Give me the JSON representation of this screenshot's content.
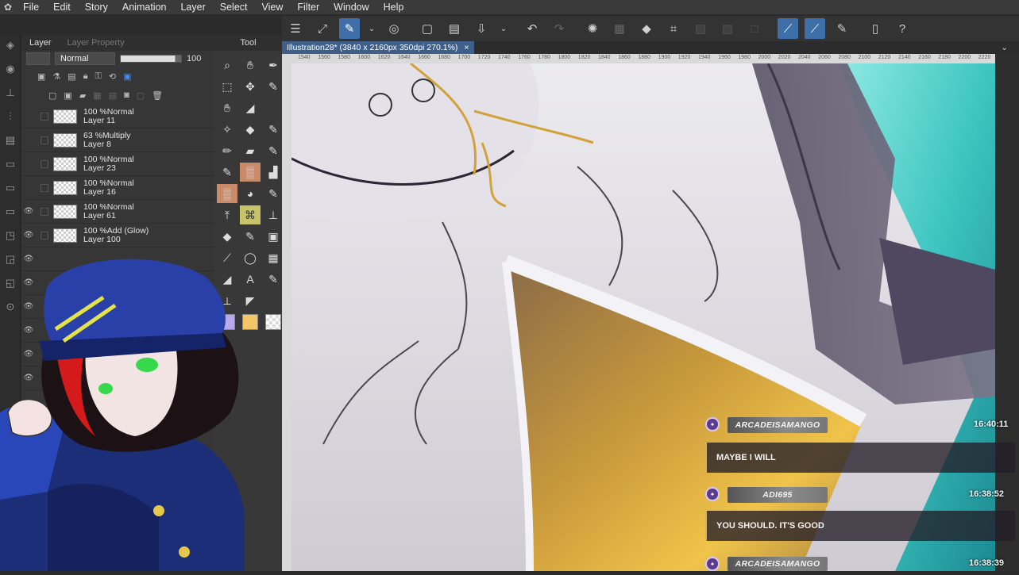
{
  "menubar": {
    "items": [
      "File",
      "Edit",
      "Story",
      "Animation",
      "Layer",
      "Select",
      "View",
      "Filter",
      "Window",
      "Help"
    ]
  },
  "layer_panel": {
    "tabs": [
      "Layer",
      "Layer Property"
    ],
    "tool_tab": "Tool",
    "blend_mode": "Normal",
    "opacity": "100",
    "layers": [
      {
        "mode": "100 %Normal",
        "name": "Layer 11"
      },
      {
        "mode": "63 %Multiply",
        "name": "Layer 8"
      },
      {
        "mode": "100 %Normal",
        "name": "Layer 23"
      },
      {
        "mode": "100 %Normal",
        "name": "Layer 16"
      },
      {
        "mode": "100 %Normal",
        "name": "Layer 61"
      },
      {
        "mode": "100 %Add (Glow)",
        "name": "Layer 100"
      }
    ]
  },
  "canvas": {
    "tab_title": "Illustration28* (3840 x 2160px 350dpi 270.1%)",
    "ruler_ticks": [
      "1540",
      "1560",
      "1580",
      "1600",
      "1620",
      "1640",
      "1660",
      "1680",
      "1700",
      "1720",
      "1740",
      "1760",
      "1780",
      "1800",
      "1820",
      "1840",
      "1860",
      "1880",
      "1900",
      "1920",
      "1940",
      "1960",
      "1980",
      "2000",
      "2020",
      "2040",
      "2060",
      "2080",
      "2100",
      "2120",
      "2140",
      "2160",
      "2180",
      "2200",
      "2220"
    ]
  },
  "chat": [
    {
      "user": "ARCADEISAMANGO",
      "message": "MAYBE I WILL",
      "time": "16:40:11"
    },
    {
      "user": "ADI695",
      "message": "YOU SHOULD. IT'S GOOD",
      "time": "16:38:52"
    },
    {
      "user": "ARCADEISAMANGO",
      "message": "",
      "time": "16:38:39"
    }
  ],
  "colors": {
    "accent": "#3f6fa8",
    "chat_name_bg": "#8a8a8a",
    "chat_border": "#d7b24a"
  }
}
